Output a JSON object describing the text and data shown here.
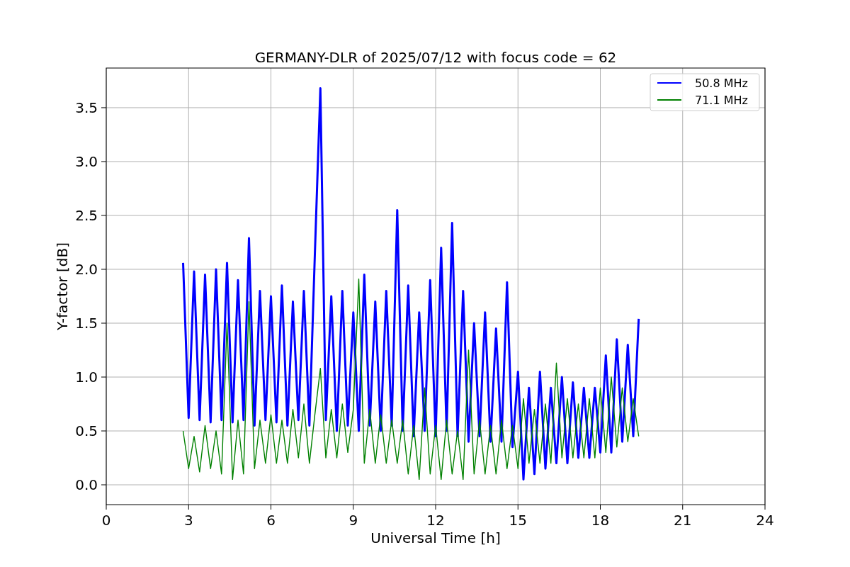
{
  "chart_data": {
    "type": "line",
    "grid": true,
    "legend": true,
    "title": "GERMANY-DLR of 2025/07/12 with focus code = 62",
    "xlabel": "Universal Time [h]",
    "ylabel": "Y-factor [dB]",
    "xlim": [
      0,
      24
    ],
    "ylim": [
      -0.184,
      3.868
    ],
    "xticks": [
      0,
      3,
      6,
      9,
      12,
      15,
      18,
      21,
      24
    ],
    "yticks": [
      {
        "value": 0,
        "label": "0.0"
      },
      {
        "value": 0.5,
        "label": "0.5"
      },
      {
        "value": 1,
        "label": "1.0"
      },
      {
        "value": 1.5,
        "label": "1.5"
      },
      {
        "value": 2,
        "label": "2.0"
      },
      {
        "value": 2.5,
        "label": "2.5"
      },
      {
        "value": 3,
        "label": "3.0"
      },
      {
        "value": 3.5,
        "label": "3.5"
      }
    ],
    "x": [
      2.8,
      3.0,
      3.2,
      3.4,
      3.6,
      3.8,
      4.0,
      4.2,
      4.4,
      4.6,
      4.8,
      5.0,
      5.2,
      5.4,
      5.6,
      5.8,
      6.0,
      6.2,
      6.4,
      6.6,
      6.8,
      7.0,
      7.2,
      7.4,
      7.6,
      7.8,
      8.0,
      8.2,
      8.4,
      8.6,
      8.8,
      9.0,
      9.2,
      9.4,
      9.6,
      9.8,
      10.0,
      10.2,
      10.4,
      10.6,
      10.8,
      11.0,
      11.2,
      11.4,
      11.6,
      11.8,
      12.0,
      12.2,
      12.4,
      12.6,
      12.8,
      13.0,
      13.2,
      13.4,
      13.6,
      13.8,
      14.0,
      14.2,
      14.4,
      14.6,
      14.8,
      15.0,
      15.2,
      15.4,
      15.6,
      15.8,
      16.0,
      16.2,
      16.4,
      16.6,
      16.8,
      17.0,
      17.2,
      17.4,
      17.6,
      17.8,
      18.0,
      18.2,
      18.4,
      18.6,
      18.8,
      19.0,
      19.2,
      19.4
    ],
    "series": [
      {
        "name": "50.8 MHz",
        "color": "#0000ff",
        "values": [
          2.06,
          0.62,
          1.98,
          0.6,
          1.95,
          0.58,
          2.0,
          0.6,
          2.06,
          0.58,
          1.9,
          0.6,
          2.29,
          0.55,
          1.8,
          0.6,
          1.75,
          0.58,
          1.85,
          0.55,
          1.7,
          0.6,
          1.8,
          0.55,
          2.14,
          3.68,
          0.6,
          1.75,
          0.5,
          1.8,
          0.55,
          1.6,
          0.5,
          1.95,
          0.55,
          1.7,
          0.5,
          1.8,
          0.55,
          2.55,
          0.5,
          1.85,
          0.45,
          1.6,
          0.5,
          1.9,
          0.45,
          2.2,
          0.5,
          2.43,
          0.45,
          1.8,
          0.4,
          1.5,
          0.45,
          1.6,
          0.4,
          1.45,
          0.4,
          1.88,
          0.35,
          1.05,
          0.05,
          0.9,
          0.1,
          1.05,
          0.15,
          0.9,
          0.2,
          1.0,
          0.2,
          0.95,
          0.25,
          0.9,
          0.25,
          0.9,
          0.3,
          1.2,
          0.3,
          1.35,
          0.4,
          1.3,
          0.45,
          1.54
        ]
      },
      {
        "name": "71.1 MHz",
        "color": "#008000",
        "values": [
          0.5,
          0.15,
          0.45,
          0.12,
          0.55,
          0.15,
          0.5,
          0.1,
          1.5,
          0.05,
          0.6,
          0.1,
          1.7,
          0.15,
          0.6,
          0.2,
          0.65,
          0.2,
          0.6,
          0.2,
          0.7,
          0.25,
          0.75,
          0.2,
          0.65,
          1.08,
          0.25,
          0.7,
          0.25,
          0.75,
          0.3,
          0.7,
          1.91,
          0.2,
          0.7,
          0.2,
          0.65,
          0.2,
          0.6,
          0.2,
          0.6,
          0.1,
          0.55,
          0.05,
          0.9,
          0.1,
          0.55,
          0.05,
          0.6,
          0.1,
          0.5,
          0.05,
          1.25,
          0.1,
          0.6,
          0.1,
          0.55,
          0.1,
          0.6,
          0.15,
          0.55,
          0.15,
          0.8,
          0.2,
          0.7,
          0.2,
          0.75,
          0.2,
          1.13,
          0.25,
          0.8,
          0.25,
          0.75,
          0.25,
          0.8,
          0.25,
          0.9,
          0.3,
          1.0,
          0.35,
          0.9,
          0.4,
          0.8,
          0.45
        ]
      }
    ]
  }
}
